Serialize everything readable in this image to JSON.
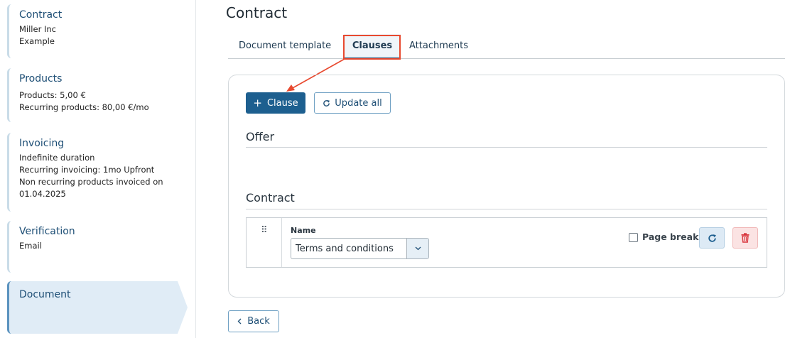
{
  "sidebar": {
    "steps": [
      {
        "title": "Contract",
        "lines": [
          "Miller Inc",
          "Example"
        ]
      },
      {
        "title": "Products",
        "lines": [
          "Products: 5,00 €",
          "Recurring products: 80,00 €/mo"
        ]
      },
      {
        "title": "Invoicing",
        "lines": [
          "Indefinite duration",
          "Recurring invoicing: 1mo Upfront",
          "Non recurring products invoiced on",
          "01.04.2025"
        ]
      },
      {
        "title": "Verification",
        "lines": [
          "Email"
        ]
      },
      {
        "title": "Document",
        "lines": []
      }
    ]
  },
  "main": {
    "title": "Contract",
    "tabs": [
      {
        "label": "Document template"
      },
      {
        "label": "Clauses",
        "active": true
      },
      {
        "label": "Attachments"
      }
    ],
    "toolbar": {
      "add_clause_label": "Clause",
      "update_all_label": "Update all"
    },
    "sections": {
      "offer": "Offer",
      "contract": "Contract"
    },
    "clause": {
      "name_label": "Name",
      "selected_value": "Terms and conditions",
      "page_break_label": "Page break",
      "page_break_checked": false
    },
    "back_label": "Back"
  },
  "colors": {
    "primary": "#1d5f8f",
    "highlight": "#e8492f",
    "delete": "#d9363e"
  }
}
